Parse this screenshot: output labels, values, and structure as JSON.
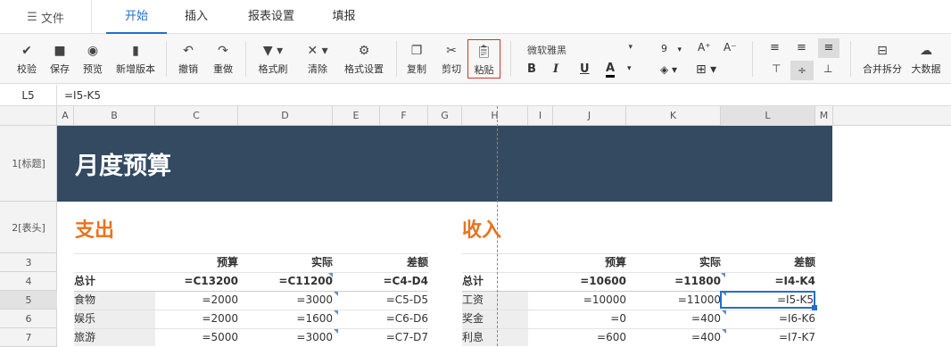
{
  "menubar": {
    "file_label": "文件",
    "tabs": [
      {
        "label": "开始"
      },
      {
        "label": "插入"
      },
      {
        "label": "报表设置"
      },
      {
        "label": "填报"
      }
    ]
  },
  "toolbar": {
    "buttons": [
      {
        "label": "校验",
        "icon": "check-circle-icon"
      },
      {
        "label": "保存",
        "icon": "save-icon"
      },
      {
        "label": "预览",
        "icon": "eye-icon"
      },
      {
        "label": "新增版本",
        "icon": "version-icon"
      },
      {
        "label": "撤销",
        "icon": "undo-icon"
      },
      {
        "label": "重做",
        "icon": "redo-icon"
      },
      {
        "label": "格式刷",
        "icon": "format-painter-icon"
      },
      {
        "label": "清除",
        "icon": "clear-icon"
      },
      {
        "label": "格式设置",
        "icon": "gear-icon"
      },
      {
        "label": "复制",
        "icon": "copy-icon"
      },
      {
        "label": "剪切",
        "icon": "scissors-icon"
      },
      {
        "label": "粘贴",
        "icon": "paste-icon"
      },
      {
        "label": "合并拆分",
        "icon": "merge-icon"
      },
      {
        "label": "大数据",
        "icon": "cloud-icon"
      }
    ],
    "font_name": "微软雅黑",
    "font_size": "9",
    "highlight_color": "#d9322c"
  },
  "formula": {
    "cell": "L5",
    "value": "=I5-K5"
  },
  "columns": [
    {
      "label": "A"
    },
    {
      "label": "B"
    },
    {
      "label": "C"
    },
    {
      "label": "D"
    },
    {
      "label": "E"
    },
    {
      "label": "F"
    },
    {
      "label": "G"
    },
    {
      "label": "H"
    },
    {
      "label": "I"
    },
    {
      "label": "J"
    },
    {
      "label": "K"
    },
    {
      "label": "L"
    },
    {
      "label": "M"
    }
  ],
  "rows": [
    {
      "label": "1[标题]"
    },
    {
      "label": "2[表头]"
    },
    {
      "label": "3"
    },
    {
      "label": "4"
    },
    {
      "label": "5"
    },
    {
      "label": "6"
    },
    {
      "label": "7"
    }
  ],
  "sheet": {
    "title": "月度预算",
    "title_bg": "#334a61",
    "accent": "#e9731d",
    "expense": {
      "heading": "支出",
      "headers": [
        "预算",
        "实际",
        "差额"
      ],
      "total": {
        "label": "总计",
        "budget": "=C13200",
        "actual": "=C11200",
        "diff": "=C4-D4"
      },
      "items": [
        {
          "label": "食物",
          "budget": "=2000",
          "actual": "=3000",
          "diff": "=C5-D5"
        },
        {
          "label": "娱乐",
          "budget": "=2000",
          "actual": "=1600",
          "diff": "=C6-D6"
        },
        {
          "label": "旅游",
          "budget": "=5000",
          "actual": "=3000",
          "diff": "=C7-D7"
        }
      ]
    },
    "income": {
      "heading": "收入",
      "headers": [
        "预算",
        "实际",
        "差额"
      ],
      "total": {
        "label": "总计",
        "budget": "=10600",
        "actual": "=11800",
        "diff": "=I4-K4"
      },
      "items": [
        {
          "label": "工资",
          "budget": "=10000",
          "actual": "=11000",
          "diff": "=I5-K5"
        },
        {
          "label": "奖金",
          "budget": "=0",
          "actual": "=400",
          "diff": "=I6-K6"
        },
        {
          "label": "利息",
          "budget": "=600",
          "actual": "=400",
          "diff": "=I7-K7"
        }
      ]
    }
  }
}
